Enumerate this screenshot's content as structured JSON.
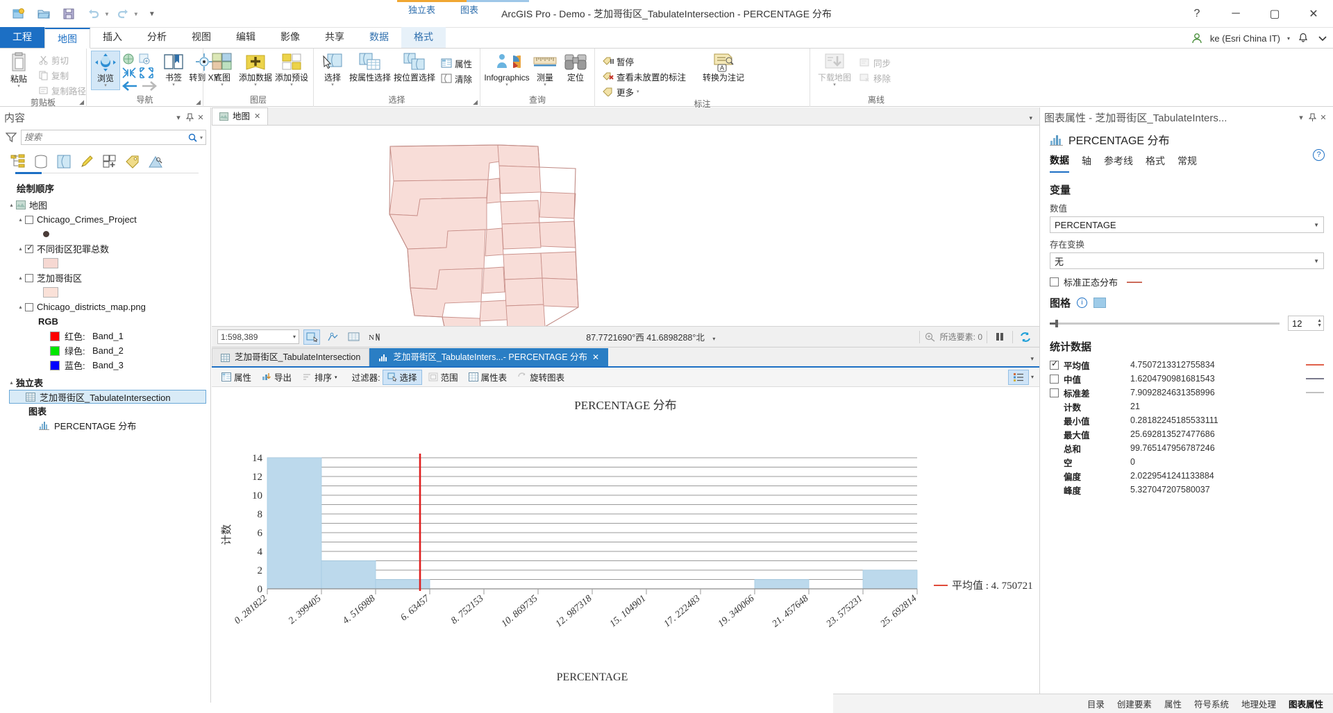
{
  "window": {
    "title": "ArcGIS Pro - Demo - 芝加哥街区_TabulateIntersection - PERCENTAGE 分布",
    "help": "?",
    "minimize": "─",
    "maximize": "▢",
    "close": "✕"
  },
  "qat": [
    {
      "name": "new-project-icon",
      "label": "新建工程"
    },
    {
      "name": "open-project-icon",
      "label": "打开工程"
    },
    {
      "name": "save-project-icon",
      "label": "保存工程"
    },
    {
      "name": "undo-icon",
      "label": "撤销"
    },
    {
      "name": "redo-icon",
      "label": "重做"
    },
    {
      "name": "customize-qat-icon",
      "label": "自定义快速访问工具栏"
    }
  ],
  "contextual_groups": [
    {
      "label": "独立表",
      "color": "#f0a732"
    },
    {
      "label": "图表",
      "color": "#9fc7e8"
    }
  ],
  "tabs": [
    {
      "label": "工程",
      "type": "project"
    },
    {
      "label": "地图",
      "type": "active"
    },
    {
      "label": "插入",
      "type": "normal"
    },
    {
      "label": "分析",
      "type": "normal"
    },
    {
      "label": "视图",
      "type": "normal"
    },
    {
      "label": "编辑",
      "type": "normal"
    },
    {
      "label": "影像",
      "type": "normal"
    },
    {
      "label": "共享",
      "type": "normal"
    },
    {
      "label": "数据",
      "type": "ctx"
    },
    {
      "label": "格式",
      "type": "ctx-sel"
    }
  ],
  "account": {
    "user": "ke (Esri China IT)",
    "caret": "▾",
    "notifications_icon": "bell-icon",
    "ribbon_options_icon": "chevron-down-icon"
  },
  "ribbon": {
    "groups": [
      {
        "name": "剪贴板",
        "has_dialog_launcher": true,
        "big": [
          {
            "label": "粘贴",
            "icon": "paste-icon",
            "caret": "▾"
          }
        ],
        "small": [
          {
            "label": "剪切",
            "icon": "cut-icon",
            "disabled": true
          },
          {
            "label": "复制",
            "icon": "copy-icon",
            "disabled": true
          },
          {
            "label": "复制路径",
            "icon": "copy-path-icon",
            "disabled": true
          }
        ]
      },
      {
        "name": "导航",
        "has_dialog_launcher": true,
        "big": [
          {
            "label": "浏览",
            "icon": "explore-icon",
            "caret": "▾",
            "selected": true
          },
          {
            "label": "书签",
            "icon": "bookmark-icon",
            "caret": "▾"
          },
          {
            "label": "转到 XY",
            "icon": "go-to-xy-icon",
            "caret": "▾"
          }
        ],
        "mini": [
          {
            "icon": "full-extent-icon"
          },
          {
            "icon": "fixed-zoom-in-icon"
          },
          {
            "icon": "zoom-out-fixed-icon"
          },
          {
            "icon": "zoom-in-fixed-icon"
          },
          {
            "icon": "previous-extent-icon"
          },
          {
            "icon": "next-extent-icon"
          }
        ]
      },
      {
        "name": "图层",
        "big": [
          {
            "label": "底图",
            "icon": "basemap-icon",
            "caret": "▾"
          },
          {
            "label": "添加数据",
            "icon": "add-data-icon",
            "caret": "▾"
          },
          {
            "label": "添加预设",
            "icon": "add-preset-icon",
            "caret": "▾"
          }
        ]
      },
      {
        "name": "选择",
        "has_dialog_launcher": true,
        "big": [
          {
            "label": "选择",
            "icon": "select-icon",
            "caret": "▾"
          },
          {
            "label": "按属性选择",
            "icon": "select-by-attributes-icon"
          },
          {
            "label": "按位置选择",
            "icon": "select-by-location-icon"
          }
        ],
        "small": [
          {
            "label": "属性",
            "icon": "attributes-icon"
          },
          {
            "label": "清除",
            "icon": "clear-selection-icon"
          }
        ]
      },
      {
        "name": "查询",
        "big": [
          {
            "label": "Infographics",
            "icon": "infographics-icon",
            "caret": "▾"
          },
          {
            "label": "测量",
            "icon": "measure-icon",
            "caret": "▾"
          },
          {
            "label": "定位",
            "icon": "locate-icon"
          }
        ]
      },
      {
        "name": "标注",
        "small": [
          {
            "label": "暂停",
            "icon": "pause-labeling-icon"
          },
          {
            "label": "查看未放置的标注",
            "icon": "view-unplaced-labels-icon"
          },
          {
            "label": "更多",
            "icon": "more-labeling-icon",
            "caret": "▾"
          }
        ],
        "big": [
          {
            "label": "转换为注记",
            "icon": "convert-to-annotation-icon"
          }
        ]
      },
      {
        "name": "离线",
        "big": [
          {
            "label": "下载地图",
            "icon": "download-map-icon",
            "caret": "▾",
            "disabled": true
          }
        ],
        "small": [
          {
            "label": "同步",
            "icon": "sync-icon",
            "disabled": true
          },
          {
            "label": "移除",
            "icon": "remove-offline-icon",
            "disabled": true
          }
        ]
      }
    ]
  },
  "contents": {
    "title": "内容",
    "pin": "📌",
    "close": "✕",
    "menu": "▾",
    "search_placeholder": "搜索",
    "search_value": "",
    "filter_icon": "filter-icon",
    "search_icon": "search-icon",
    "search_caret": "▾",
    "view_tabs": [
      {
        "name": "list-by-drawing-order-icon",
        "active": true
      },
      {
        "name": "list-by-data-source-icon",
        "active": false
      },
      {
        "name": "list-by-selection-icon",
        "active": false
      },
      {
        "name": "list-by-editing-icon",
        "active": false
      },
      {
        "name": "list-by-snapping-icon",
        "active": false
      },
      {
        "name": "list-by-labeling-icon",
        "active": false
      },
      {
        "name": "list-by-diagrams-icon",
        "active": false
      }
    ],
    "drawing_order_label": "绘制顺序",
    "tree": [
      {
        "indent": 0,
        "twisty": "▴",
        "icon": "map-icon",
        "label": "地图",
        "type": "map"
      },
      {
        "indent": 1,
        "twisty": "▴",
        "checkbox": false,
        "label": "Chicago_Crimes_Project",
        "type": "layer"
      },
      {
        "indent": 2,
        "symbol": "point",
        "label": "",
        "type": "symbol"
      },
      {
        "indent": 1,
        "twisty": "▴",
        "checkbox": true,
        "label": "不同街区犯罪总数",
        "type": "layer"
      },
      {
        "indent": 2,
        "swatch": "#f6d8d2",
        "label": "",
        "type": "symbol"
      },
      {
        "indent": 1,
        "twisty": "▴",
        "checkbox": false,
        "label": "芝加哥街区",
        "type": "layer"
      },
      {
        "indent": 2,
        "swatch": "#fae1d8",
        "label": "",
        "type": "symbol"
      },
      {
        "indent": 1,
        "twisty": "▴",
        "checkbox": false,
        "label": "Chicago_districts_map.png",
        "type": "layer"
      },
      {
        "indent": 2,
        "label": "RGB",
        "type": "text-bold"
      },
      {
        "indent": 3,
        "swatch": "#ff0000",
        "label": "红色:",
        "extra": "Band_1",
        "type": "band"
      },
      {
        "indent": 3,
        "swatch": "#00e600",
        "label": "绿色:",
        "extra": "Band_2",
        "type": "band"
      },
      {
        "indent": 3,
        "swatch": "#0000ff",
        "label": "蓝色:",
        "extra": "Band_3",
        "type": "band"
      },
      {
        "indent": 0,
        "twisty": "▴",
        "label": "独立表",
        "type": "text-bold"
      },
      {
        "indent": 1,
        "icon": "table-icon",
        "label": "芝加哥街区_TabulateIntersection",
        "type": "table",
        "selected": true
      },
      {
        "indent": 1,
        "label": "图表",
        "type": "text-bold"
      },
      {
        "indent": 2,
        "icon": "chart-icon",
        "label": "PERCENTAGE 分布",
        "type": "chart"
      }
    ]
  },
  "map": {
    "tab_label": "地图",
    "tab_icon": "map-icon",
    "tab_close": "✕",
    "collapse": "▾",
    "scale": "1:598,389",
    "scale_caret": "▾",
    "coordinates": "87.7721690°西 41.6898288°北",
    "coord_caret": "▾",
    "selected_features_label": "所选要素: 0",
    "selected_features_icon": "selected-features-icon",
    "pause_icon": "pause-drawing-icon",
    "refresh_icon": "refresh-icon",
    "tools": [
      {
        "name": "enable-selection-icon",
        "selected": true
      },
      {
        "name": "snapping-icon",
        "selected": false
      },
      {
        "name": "attribute-table-icon",
        "selected": false
      },
      {
        "name": "north-arrow-icon",
        "selected": false
      }
    ]
  },
  "chart_panel": {
    "tabs": [
      {
        "label": "芝加哥街区_TabulateIntersection",
        "icon": "table-icon",
        "active": false
      },
      {
        "label": "芝加哥街区_TabulateInters...- PERCENTAGE 分布",
        "icon": "chart-icon",
        "active": true,
        "close": "✕"
      }
    ],
    "collapse": "▾",
    "toolbar": [
      {
        "label": "属性",
        "icon": "properties-icon",
        "disabled": false
      },
      {
        "label": "导出",
        "icon": "export-icon",
        "disabled": false
      },
      {
        "label": "排序",
        "icon": "sort-icon",
        "caret": "▾",
        "disabled": true
      },
      {
        "label": "过滤器:",
        "type": "label"
      },
      {
        "label": "选择",
        "icon": "filter-selection-icon",
        "selected": true
      },
      {
        "label": "范围",
        "icon": "filter-extent-icon",
        "disabled": true
      },
      {
        "label": "属性表",
        "icon": "attribute-table-icon",
        "disabled": false
      },
      {
        "label": "旋转图表",
        "icon": "rotate-chart-icon",
        "disabled": true
      }
    ],
    "legend_toggle_icon": "legend-icon",
    "legend_caret": "▾"
  },
  "chart_data": {
    "type": "bar",
    "title": "PERCENTAGE 分布",
    "xlabel": "PERCENTAGE",
    "ylabel": "计数",
    "grid": true,
    "bar_color": "#bcd9ec",
    "bar_border": "#9fc4dc",
    "ylim": [
      0,
      14
    ],
    "yticks": [
      0,
      2,
      4,
      6,
      8,
      10,
      12,
      14
    ],
    "categories": [
      "0. 281822",
      "2. 399405",
      "4. 516988",
      "6. 63457",
      "8. 752153",
      "10. 869735",
      "12. 987318",
      "15. 104901",
      "17. 222483",
      "19. 340066",
      "21. 457648",
      "23. 575231",
      "25. 692814"
    ],
    "values": [
      14,
      3,
      1,
      0,
      0,
      0,
      0,
      0,
      0,
      1,
      0,
      2
    ],
    "mean_line": {
      "value": 4.750721,
      "color": "#e02020",
      "legend": "— 平均值 :  4. 750721"
    },
    "legend_label": "平均值 :  4. 750721"
  },
  "properties": {
    "header": "图表属性 - 芝加哥街区_TabulateInters...",
    "pin": "📌",
    "close": "✕",
    "menu": "▾",
    "chart_name": "PERCENTAGE 分布",
    "chart_icon": "chart-icon",
    "help": "?",
    "tabs": [
      {
        "label": "数据",
        "active": true
      },
      {
        "label": "轴",
        "active": false
      },
      {
        "label": "参考线",
        "active": false
      },
      {
        "label": "格式",
        "active": false
      },
      {
        "label": "常规",
        "active": false
      }
    ],
    "variable_section": "变量",
    "number_label": "数值",
    "number_value": "PERCENTAGE",
    "transform_label": "存在变换",
    "transform_value": "无",
    "normal_dist_label": "标准正态分布",
    "normal_dist_checked": false,
    "normal_dist_line_color": "#cc6b5a",
    "bins_label": "图格",
    "bins_info": "i",
    "bins_swatch": "#9ecbe8",
    "bins_value": "12",
    "stats_section": "统计数据",
    "stats": [
      {
        "label": "平均值",
        "value": "4.7507213312755834",
        "checkbox": true,
        "checked": true,
        "line": "#e0604a"
      },
      {
        "label": "中值",
        "value": "1.6204790981681543",
        "checkbox": true,
        "checked": false,
        "line": "#7a7a8c"
      },
      {
        "label": "标准差",
        "value": "7.9092824631358996",
        "checkbox": true,
        "checked": false,
        "line": "#b8b8b8"
      },
      {
        "label": "计数",
        "value": "21",
        "checkbox": false
      },
      {
        "label": "最小值",
        "value": "0.28182245185533111",
        "checkbox": false
      },
      {
        "label": "最大值",
        "value": "25.692813527477686",
        "checkbox": false
      },
      {
        "label": "总和",
        "value": "99.765147956787246",
        "checkbox": false
      },
      {
        "label": "空",
        "value": "0",
        "checkbox": false
      },
      {
        "label": "偏度",
        "value": "2.0229541241133884",
        "checkbox": false
      },
      {
        "label": "峰度",
        "value": "5.327047207580037",
        "checkbox": false
      }
    ]
  },
  "bottom_tabs": [
    {
      "label": "目录",
      "active": false
    },
    {
      "label": "创建要素",
      "active": false
    },
    {
      "label": "属性",
      "active": false
    },
    {
      "label": "符号系统",
      "active": false
    },
    {
      "label": "地理处理",
      "active": false
    },
    {
      "label": "图表属性",
      "active": true
    }
  ]
}
